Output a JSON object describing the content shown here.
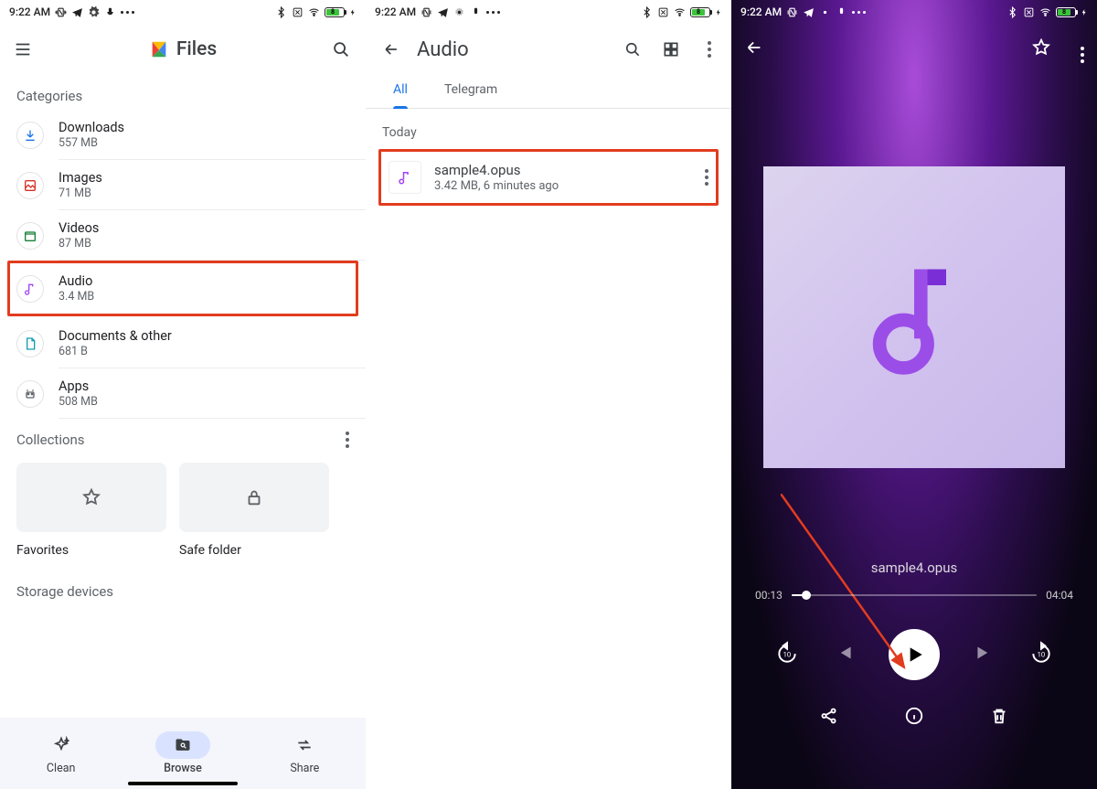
{
  "status": {
    "time": "9:22 AM",
    "battery_label": "8"
  },
  "p1": {
    "app_title": "Files",
    "section_categories": "Categories",
    "categories": [
      {
        "name": "Downloads",
        "size": "557 MB"
      },
      {
        "name": "Images",
        "size": "71 MB"
      },
      {
        "name": "Videos",
        "size": "87 MB"
      },
      {
        "name": "Audio",
        "size": "3.4 MB"
      },
      {
        "name": "Documents & other",
        "size": "681 B"
      },
      {
        "name": "Apps",
        "size": "508 MB"
      }
    ],
    "section_collections": "Collections",
    "cards": {
      "favorites": "Favorites",
      "safe_folder": "Safe folder"
    },
    "section_storage": "Storage devices",
    "tabs": {
      "clean": "Clean",
      "browse": "Browse",
      "share": "Share"
    }
  },
  "p2": {
    "title": "Audio",
    "tabs": {
      "all": "All",
      "telegram": "Telegram"
    },
    "group_today": "Today",
    "file": {
      "name": "sample4.opus",
      "meta": "3.42 MB, 6 minutes ago"
    }
  },
  "p3": {
    "track": "sample4.opus",
    "time_current": "00:13",
    "time_total": "04:04"
  }
}
